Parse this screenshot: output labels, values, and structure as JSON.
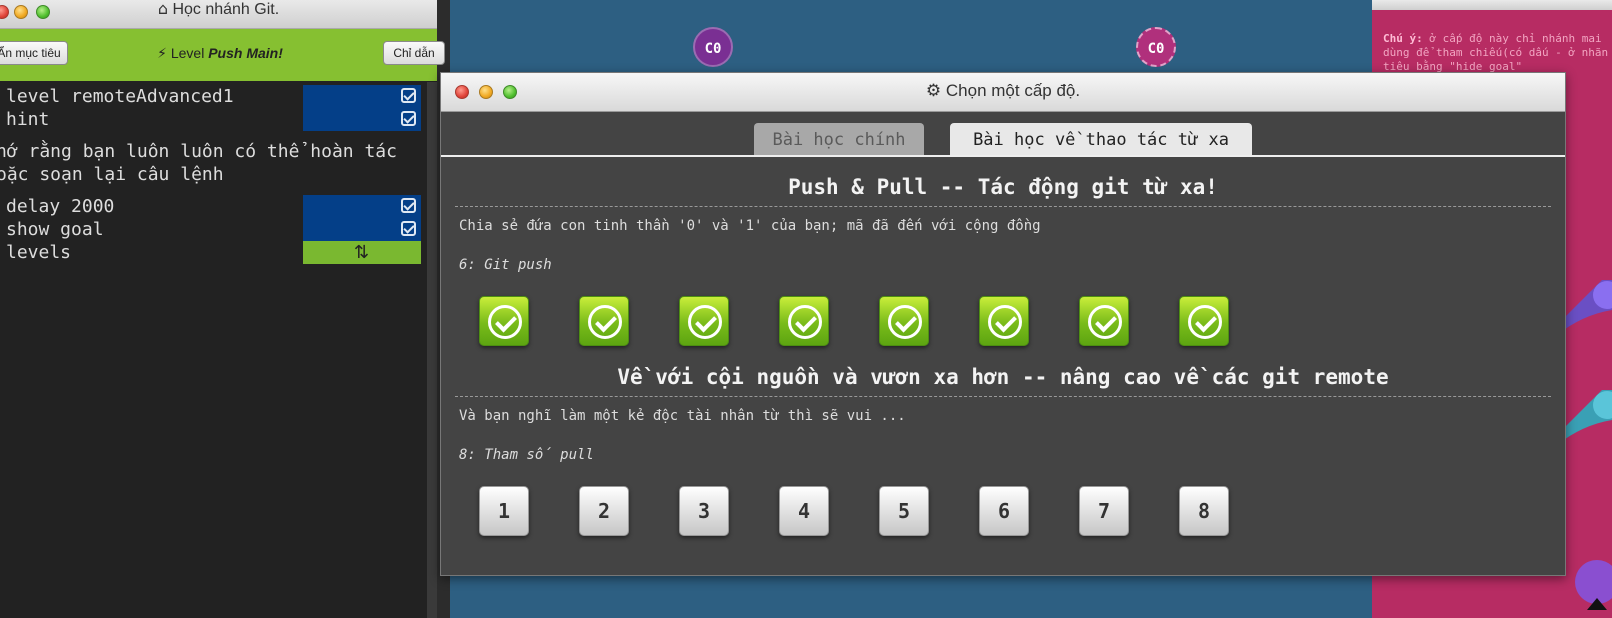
{
  "left_window": {
    "title": "Học nhánh Git.",
    "objectives_button": "Ẩn mục tiêu",
    "level_prefix": "Level",
    "level_name": "Push Main!",
    "hint_button": "Chỉ dẫn",
    "commands": [
      {
        "text": "level remoteAdvanced1"
      },
      {
        "text": "hint"
      }
    ],
    "message_line1": "hớ rằng bạn luôn luôn có thể hoàn tác",
    "message_line2": "oặc soạn lại câu lệnh",
    "commands2": [
      {
        "text": "delay 2000"
      },
      {
        "text": "show goal"
      },
      {
        "text": "levels"
      }
    ]
  },
  "viz": {
    "node1_label": "C0",
    "node2_label": "C0"
  },
  "goal_window": {
    "note_bold": "Chú ý:",
    "note_text": "ở cấp độ này chỉ nhánh mai dùng để tham chiếu(có dấu - ở nhãn tiêu bằng \"hide goal\""
  },
  "dialog": {
    "title": "Chọn một cấp độ.",
    "tab_main": "Bài học chính",
    "tab_remote": "Bài học về thao tác từ xa",
    "sequences": [
      {
        "title": "Push & Pull -- Tác động git từ xa!",
        "about": "Chia sẻ đứa con tinh thần '0' và '1' của bạn; mã đã đến với cộng đồng",
        "current_level": "6: Git push",
        "levels_completed": 8
      },
      {
        "title": "Về với cội nguồn và vươn xa hơn -- nâng cao về các git remote",
        "about": "Và bạn nghĩ làm một kẻ độc tài nhân từ thì sẽ vui ...",
        "current_level": "8: Tham số pull",
        "levels": [
          "1",
          "2",
          "3",
          "4",
          "5",
          "6",
          "7",
          "8"
        ]
      }
    ]
  },
  "colors": {
    "dialog_bg": "#444444",
    "viz_bg": "#2d5f82",
    "goal_bg": "#b72c63",
    "toolbar_green": "#86c031",
    "command_blue": "#043f88"
  },
  "icons": {
    "left_title": "home-icon",
    "level_label": "bolt-icon",
    "dialog_title": "gear-icon",
    "levels_command": "swap-icon",
    "completed_level": "check-circle-icon"
  }
}
